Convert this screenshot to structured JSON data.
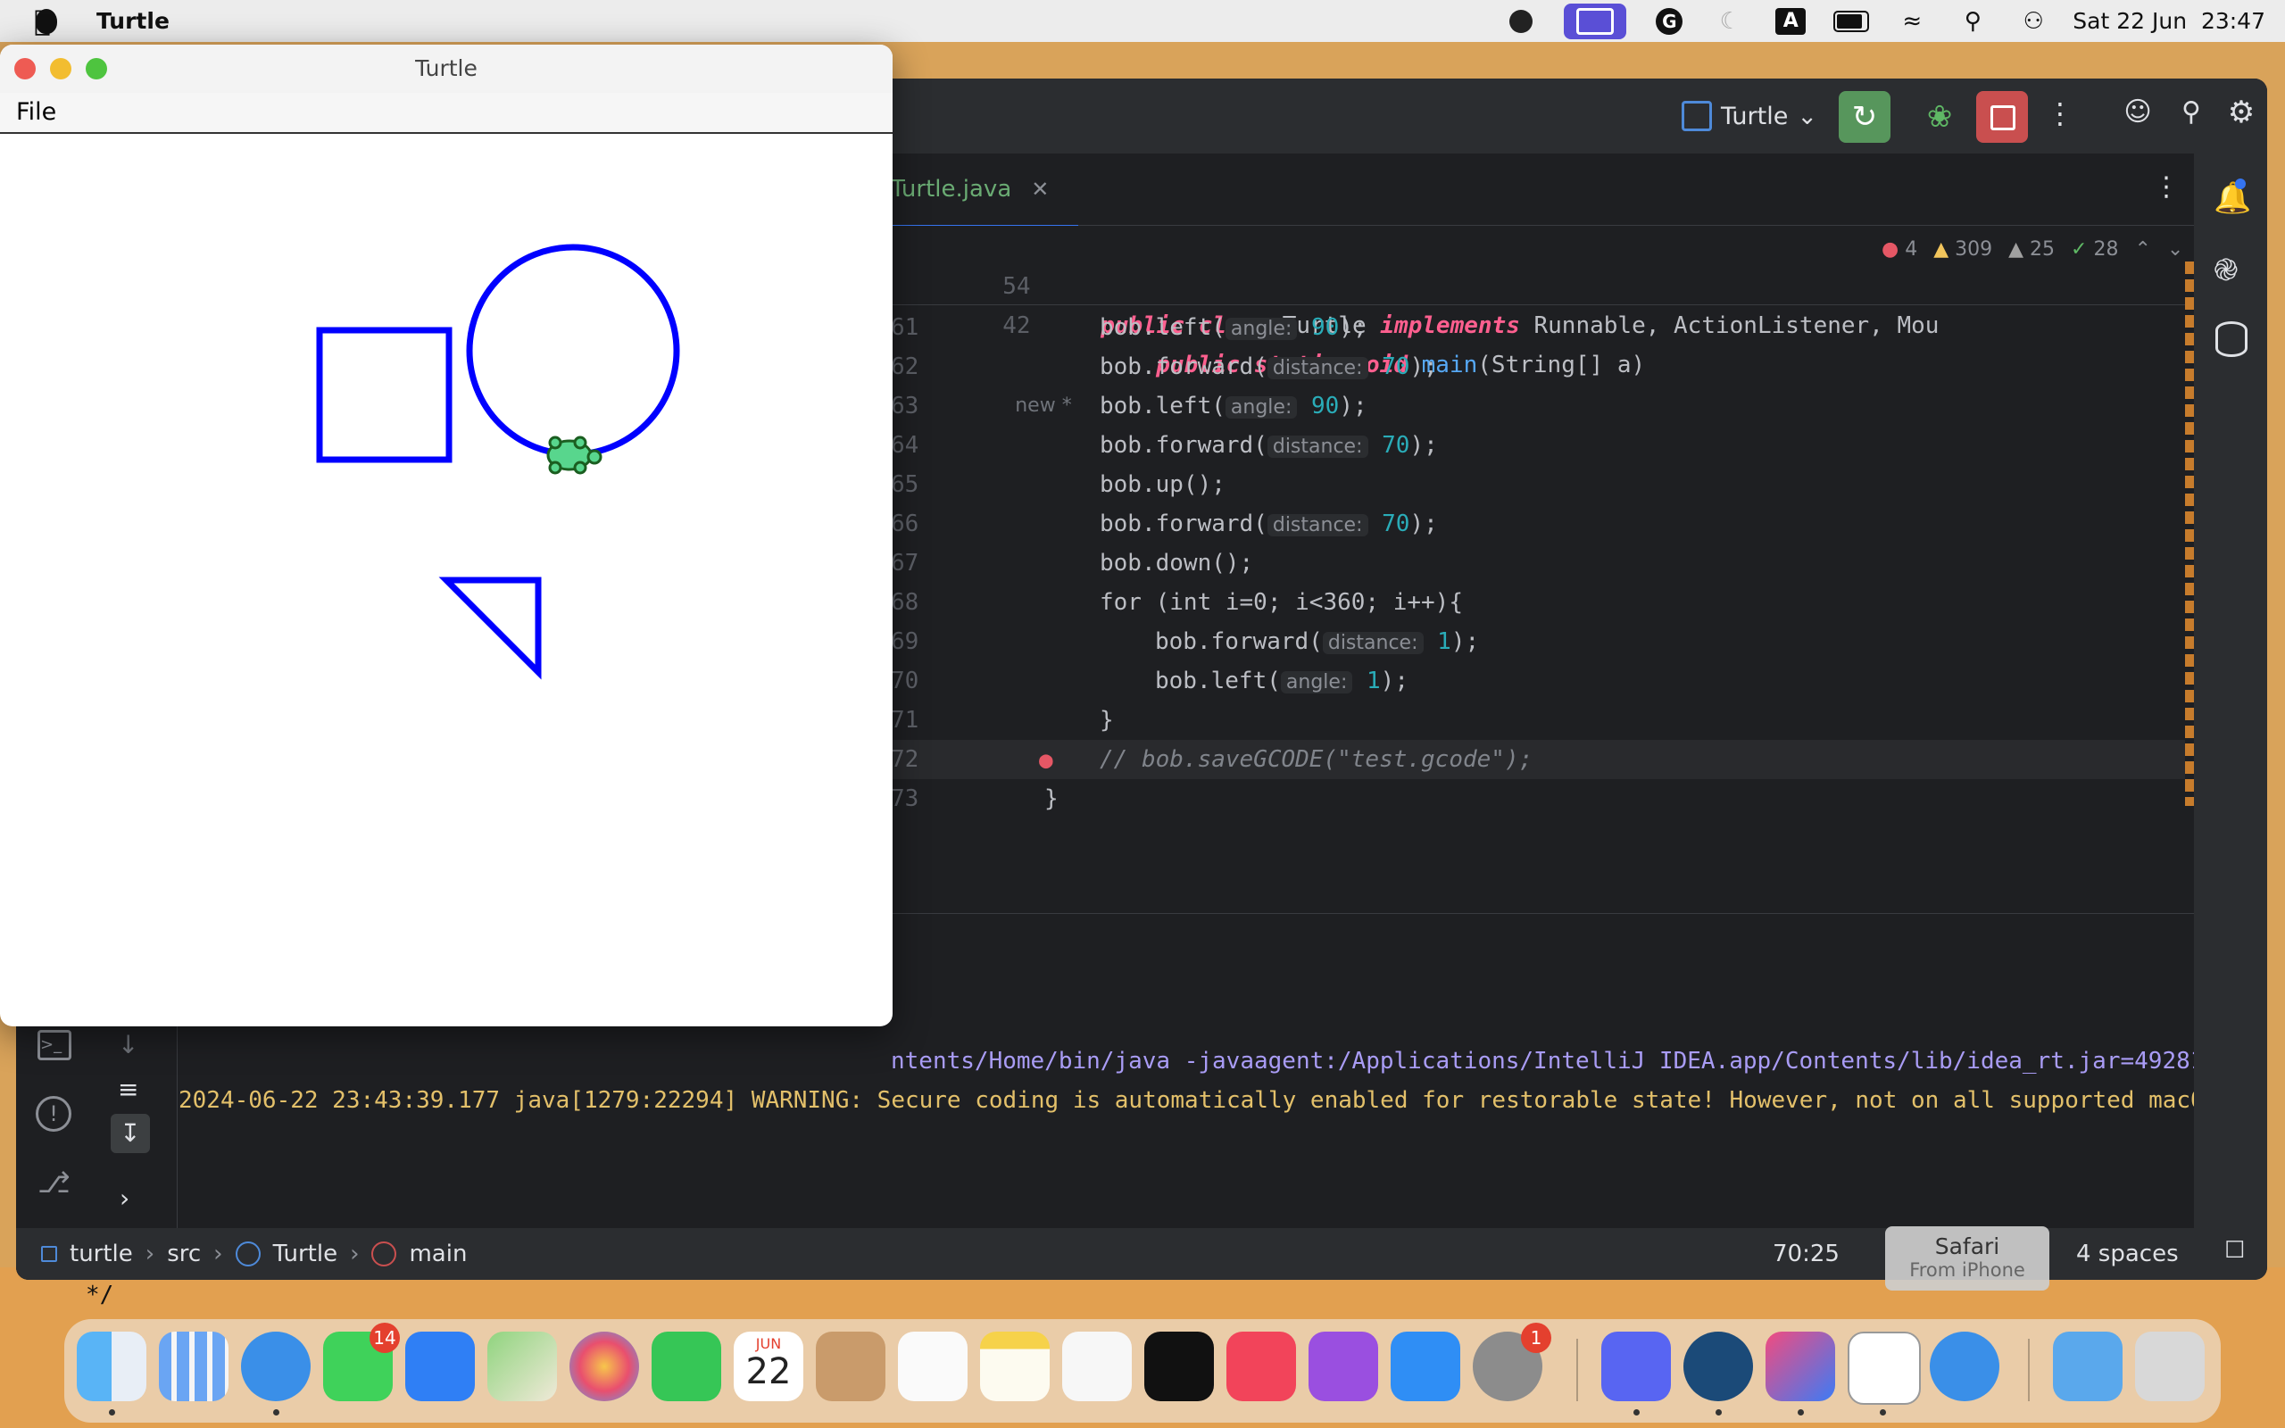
{
  "menubar": {
    "app_name": "Turtle",
    "datetime": "Sat 22 Jun  23:47"
  },
  "ide": {
    "run_config": "Turtle",
    "tab_file": "Turtle.java",
    "sticky_line1": {
      "num": "54",
      "text_pre": "public class ",
      "name": "Turtle",
      "impl": " implements ",
      "ifaces": "Runnable, ActionListener, Mou"
    },
    "sticky_line2": {
      "num": "42",
      "text": "public static void main(String[] a)",
      "suffix": "new *"
    },
    "inspections": {
      "errors": "4",
      "warnings": "309",
      "weak": "25",
      "ok": "28"
    },
    "code_lines": [
      {
        "num": "61",
        "obj": "bob",
        "call": "left",
        "hint": "angle:",
        "arg": "90",
        "indent": 2
      },
      {
        "num": "62",
        "obj": "bob",
        "call": "forward",
        "hint": "distance:",
        "arg": "70",
        "indent": 2
      },
      {
        "num": "63",
        "obj": "bob",
        "call": "left",
        "hint": "angle:",
        "arg": "90",
        "indent": 2
      },
      {
        "num": "64",
        "obj": "bob",
        "call": "forward",
        "hint": "distance:",
        "arg": "70",
        "indent": 2
      },
      {
        "num": "65",
        "obj": "bob",
        "call": "up",
        "hint": "",
        "arg": "",
        "indent": 2
      },
      {
        "num": "66",
        "obj": "bob",
        "call": "forward",
        "hint": "distance:",
        "arg": "70",
        "indent": 2
      },
      {
        "num": "67",
        "obj": "bob",
        "call": "down",
        "hint": "",
        "arg": "",
        "indent": 2
      },
      {
        "num": "68",
        "raw": "for (int i=0; i<360; i++){",
        "indent": 2
      },
      {
        "num": "69",
        "obj": "bob",
        "call": "forward",
        "hint": "distance:",
        "arg": "1",
        "indent": 3
      },
      {
        "num": "70",
        "obj": "bob",
        "call": "left",
        "hint": "angle:",
        "arg": "1",
        "indent": 3
      },
      {
        "num": "71",
        "raw": "}",
        "indent": 2
      },
      {
        "num": "72",
        "raw": "// bob.saveGCODE(\"test.gcode\");",
        "indent": 2
      },
      {
        "num": "73",
        "raw": "}",
        "indent": 1
      }
    ],
    "console_line1": "ntents/Home/bin/java -javaagent:/Applications/IntelliJ IDEA.app/Contents/lib/idea_rt.jar=49281",
    "console_line2": "2024-06-22 23:43:39.177 java[1279:22294] WARNING: Secure coding is automatically enabled for restorable state! However, not on all supported macO",
    "breadcrumbs": [
      "turtle",
      "src",
      "Turtle",
      "main"
    ],
    "caret": "70:25",
    "indent": "4 spaces",
    "below_text": "*/"
  },
  "turtle_window": {
    "title": "Turtle",
    "menu_file": "File"
  },
  "safari_handoff": {
    "title": "Safari",
    "subtitle": "From iPhone"
  },
  "dock": {
    "calendar_month": "JUN",
    "calendar_day": "22",
    "messages_badge": "14",
    "settings_badge": "1"
  },
  "colors": {
    "turtle_stroke": "#0000ff",
    "ide_bg": "#1e1f22"
  }
}
